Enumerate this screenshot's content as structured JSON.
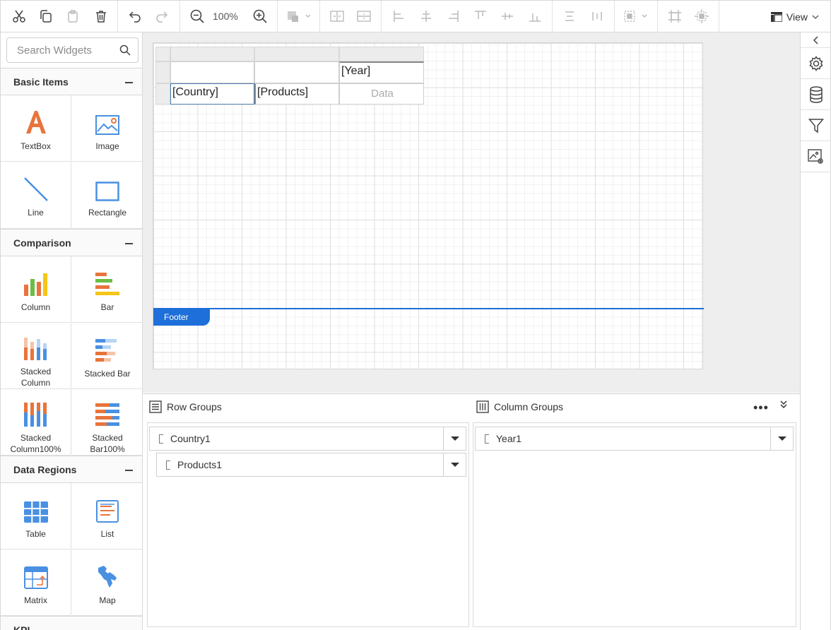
{
  "toolbar": {
    "zoom": "100%",
    "view_label": "View"
  },
  "sidebar": {
    "search_placeholder": "Search Widgets",
    "sections": {
      "basic": {
        "title": "Basic Items",
        "items": [
          "TextBox",
          "Image",
          "Line",
          "Rectangle"
        ]
      },
      "comparison": {
        "title": "Comparison",
        "items": [
          "Column",
          "Bar",
          "Stacked Column",
          "Stacked Bar",
          "Stacked Column100%",
          "Stacked Bar100%"
        ]
      },
      "data_regions": {
        "title": "Data Regions",
        "items": [
          "Table",
          "List",
          "Matrix",
          "Map"
        ]
      },
      "next": {
        "title": "KPI"
      }
    }
  },
  "canvas": {
    "matrix": {
      "year_cell": "[Year]",
      "country_cell": "[Country]",
      "products_cell": "[Products]",
      "data_cell": "Data"
    },
    "footer_label": "Footer"
  },
  "groups": {
    "row_groups_title": "Row Groups",
    "column_groups_title": "Column Groups",
    "row_groups": [
      "Country1",
      "Products1"
    ],
    "column_groups": [
      "Year1"
    ]
  },
  "colors": {
    "accent": "#1e6fd9",
    "orange": "#e8743b",
    "blue_icon": "#4a90e2"
  }
}
